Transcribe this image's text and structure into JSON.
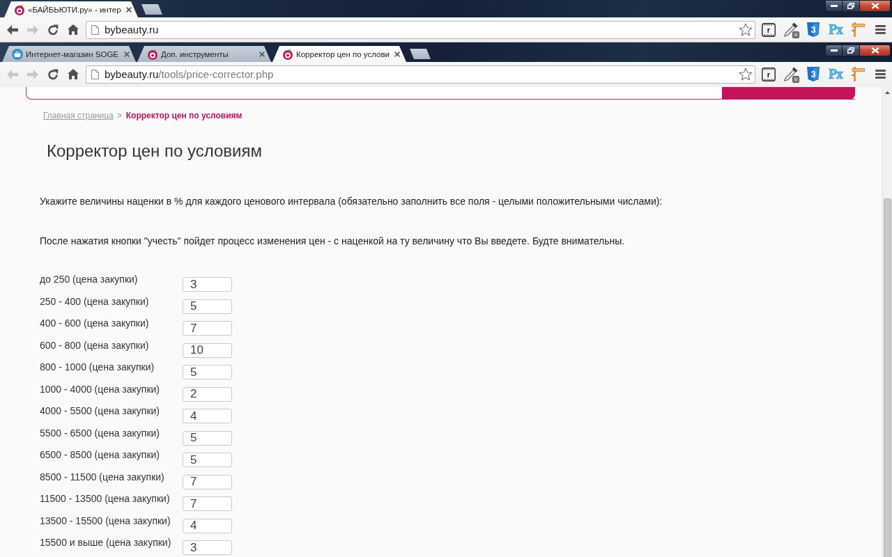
{
  "windows": [
    {
      "tabs": [
        {
          "kind": "logo",
          "title": "«БАЙБЬЮТИ.ру» - интер",
          "selected": true
        }
      ],
      "back": {
        "disabled": false
      },
      "forward": {
        "disabled": true
      },
      "url": {
        "host": "bybeauty.ru"
      },
      "extensions": [
        {
          "kind": "ruler",
          "label": "r"
        },
        {
          "kind": "dropper"
        },
        {
          "kind": "css",
          "label": "3"
        },
        {
          "kind": "px",
          "label": "Px"
        },
        {
          "kind": "sign"
        }
      ]
    },
    {
      "tabs": [
        {
          "kind": "basket",
          "title": "Интернет-магазин SOGE",
          "selected": false
        },
        {
          "kind": "logo",
          "title": "Доп. инструменты",
          "selected": false
        },
        {
          "kind": "logo",
          "title": "Корректор цен по услови",
          "selected": true
        }
      ],
      "back": {
        "disabled": true
      },
      "forward": {
        "disabled": true
      },
      "url": {
        "host": "bybeauty.ru",
        "path": "/tools/price-corrector.php"
      },
      "extensions": [
        {
          "kind": "ruler",
          "label": "r"
        },
        {
          "kind": "dropper"
        },
        {
          "kind": "css",
          "label": "3"
        },
        {
          "kind": "px",
          "label": "Px"
        },
        {
          "kind": "sign"
        }
      ]
    }
  ],
  "page": {
    "breadcrumb_separator": ">",
    "breadcrumbs": [
      {
        "label": "Главная страница",
        "current": false
      },
      {
        "label": "Корректор цен по условиям",
        "current": true
      }
    ],
    "heading": "Корректор цен по условиям",
    "paragraphs": [
      "Укажите величины наценки в % для каждого ценового интервала (обязательно заполнить все поля - целыми положительными числами):",
      "После нажатия кнопки \"учесть\" пойдет процесс изменения цен - с наценкой на ту величину что Вы введете. Будте внимательны."
    ],
    "markups": [
      {
        "label": "до 250 (цена закупки)",
        "value": "3"
      },
      {
        "label": "250 - 400 (цена закупки)",
        "value": "5"
      },
      {
        "label": "400 - 600 (цена закупки)",
        "value": "7"
      },
      {
        "label": "600 - 800 (цена закупки)",
        "value": "10"
      },
      {
        "label": "800 - 1000 (цена закупки)",
        "value": "5"
      },
      {
        "label": "1000 - 4000 (цена закупки)",
        "value": "2"
      },
      {
        "label": "4000 - 5500 (цена закупки)",
        "value": "4"
      },
      {
        "label": "5500 - 6500 (цена закупки)",
        "value": "5"
      },
      {
        "label": "6500 - 8500 (цена закупки)",
        "value": "5"
      },
      {
        "label": "8500 - 11500 (цена закупки)",
        "value": "7"
      },
      {
        "label": "11500 - 13500 (цена закупки)",
        "value": "7"
      },
      {
        "label": "13500 - 15500 (цена закупки)",
        "value": "4"
      },
      {
        "label": "15500 и выше (цена закупки)",
        "value": "3"
      }
    ]
  }
}
